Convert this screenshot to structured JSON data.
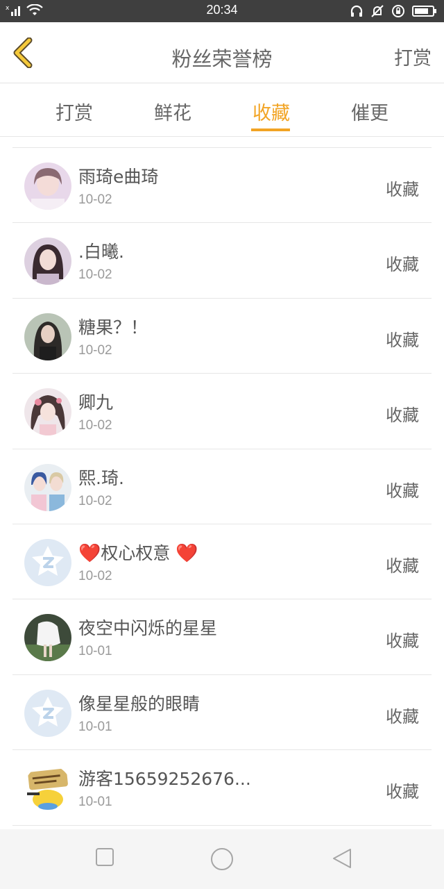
{
  "status_bar": {
    "time": "20:34"
  },
  "header": {
    "title": "粉丝荣誉榜",
    "right_action": "打赏"
  },
  "tabs": [
    {
      "label": "打赏",
      "active": false
    },
    {
      "label": "鲜花",
      "active": false
    },
    {
      "label": "收藏",
      "active": true
    },
    {
      "label": "催更",
      "active": false
    }
  ],
  "accent_color": "#f2a424",
  "list": [
    {
      "name": "雨琦e曲琦",
      "date": "10-02",
      "action": "收藏",
      "avatar": "photo"
    },
    {
      "name": ".白曦.",
      "date": "10-02",
      "action": "收藏",
      "avatar": "photo"
    },
    {
      "name": "糖果？！",
      "date": "10-02",
      "action": "收藏",
      "avatar": "photo"
    },
    {
      "name": "卿九",
      "date": "10-02",
      "action": "收藏",
      "avatar": "photo"
    },
    {
      "name": "熙.琦.",
      "date": "10-02",
      "action": "收藏",
      "avatar": "photo"
    },
    {
      "name": "权心权意",
      "date": "10-02",
      "action": "收藏",
      "avatar": "default-qq",
      "hearts": true
    },
    {
      "name": "夜空中闪烁的星星",
      "date": "10-01",
      "action": "收藏",
      "avatar": "photo"
    },
    {
      "name": "像星星般的眼睛",
      "date": "10-01",
      "action": "收藏",
      "avatar": "default-qq"
    },
    {
      "name": "游客15659252676...",
      "date": "10-01",
      "action": "收藏",
      "avatar": "sticker"
    }
  ]
}
